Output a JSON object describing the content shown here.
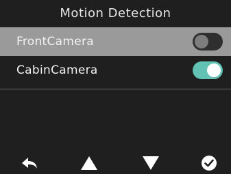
{
  "screen": {
    "title": "Motion Detection",
    "colors": {
      "background": "#1f1f1f",
      "selected_row": "#9a9a9a",
      "toggle_on": "#62c3b5",
      "toggle_off": "#2f2f2f",
      "text": "#f2f2f2"
    }
  },
  "menu": {
    "items": [
      {
        "label": "FrontCamera",
        "toggle": "off",
        "selected": true
      },
      {
        "label": "CabinCamera",
        "toggle": "on",
        "selected": false
      }
    ]
  },
  "bottom_bar": {
    "buttons": [
      {
        "icon": "back-arrow-icon"
      },
      {
        "icon": "up-triangle-icon"
      },
      {
        "icon": "down-triangle-icon"
      },
      {
        "icon": "check-circle-icon"
      }
    ]
  }
}
